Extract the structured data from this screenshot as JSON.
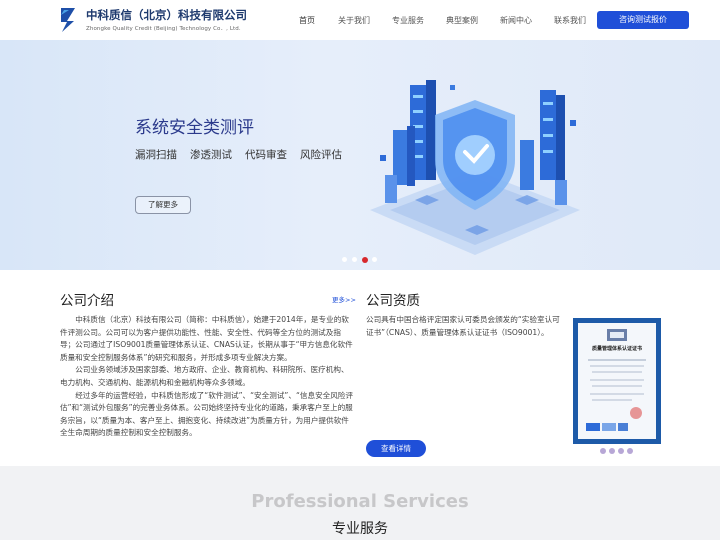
{
  "header": {
    "brand_cn": "中科质信（北京）科技有限公司",
    "brand_en": "Zhongke Quality Credit (Beijing) Technology Co．, Ltd.",
    "nav": [
      "首页",
      "关于我们",
      "专业服务",
      "典型案例",
      "新闻中心",
      "联系我们"
    ],
    "cta_label": "咨询测试报价"
  },
  "banner": {
    "title": "系统安全类测评",
    "tags": [
      "漏洞扫描",
      "渗透测试",
      "代码审查",
      "风险评估"
    ],
    "more_label": "了解更多",
    "slides": 4,
    "active_slide": 3
  },
  "intro": {
    "title": "公司介绍",
    "more_label": "更多>>",
    "paragraphs": [
      "中科质信（北京）科技有限公司（简称：中科质信），始建于2014年，是专业的软件评测公司。公司可以为客户提供功能性、性能、安全性、代码等全方位的测试及指导；公司通过了ISO9001质量管理体系认证、CNAS认证，长期从事于“甲方信息化软件质量和安全控制服务体系”的研究和服务，并形成多项专业解决方案。",
      "公司业务领域涉及国家部委、地方政府、企业、教育机构、科研院所、医疗机构、电力机构、交通机构、能源机构和金融机构等众多领域。",
      "经过多年的运营经验，中科质信形成了“软件测试”、“安全测试”、“信息安全风险评估”和“测试外包服务”的完善业务体系。公司始终坚持专业化的道路，秉承客户至上的服务宗旨，以“质量为本、客户至上、拥抱变化、持续改进”为质量方针，为用户提供软件全生命周期的质量控制和安全控制服务。"
    ]
  },
  "qualification": {
    "title": "公司资质",
    "text": "公司具有中国合格评定国家认可委员会颁发的“实验室认可证书”（CNAS）、质量管理体系认证证书（ISO9001）。",
    "detail_label": "查看详情",
    "cert_title": "质量管理体系认证证书"
  },
  "services": {
    "title_en": "Professional Services",
    "title_cn": "专业服务"
  },
  "colors": {
    "primary": "#1f4fd8",
    "brand_dark": "#1e3a6e",
    "banner_title": "#2b3a8c",
    "slide_active": "#d7282c"
  }
}
